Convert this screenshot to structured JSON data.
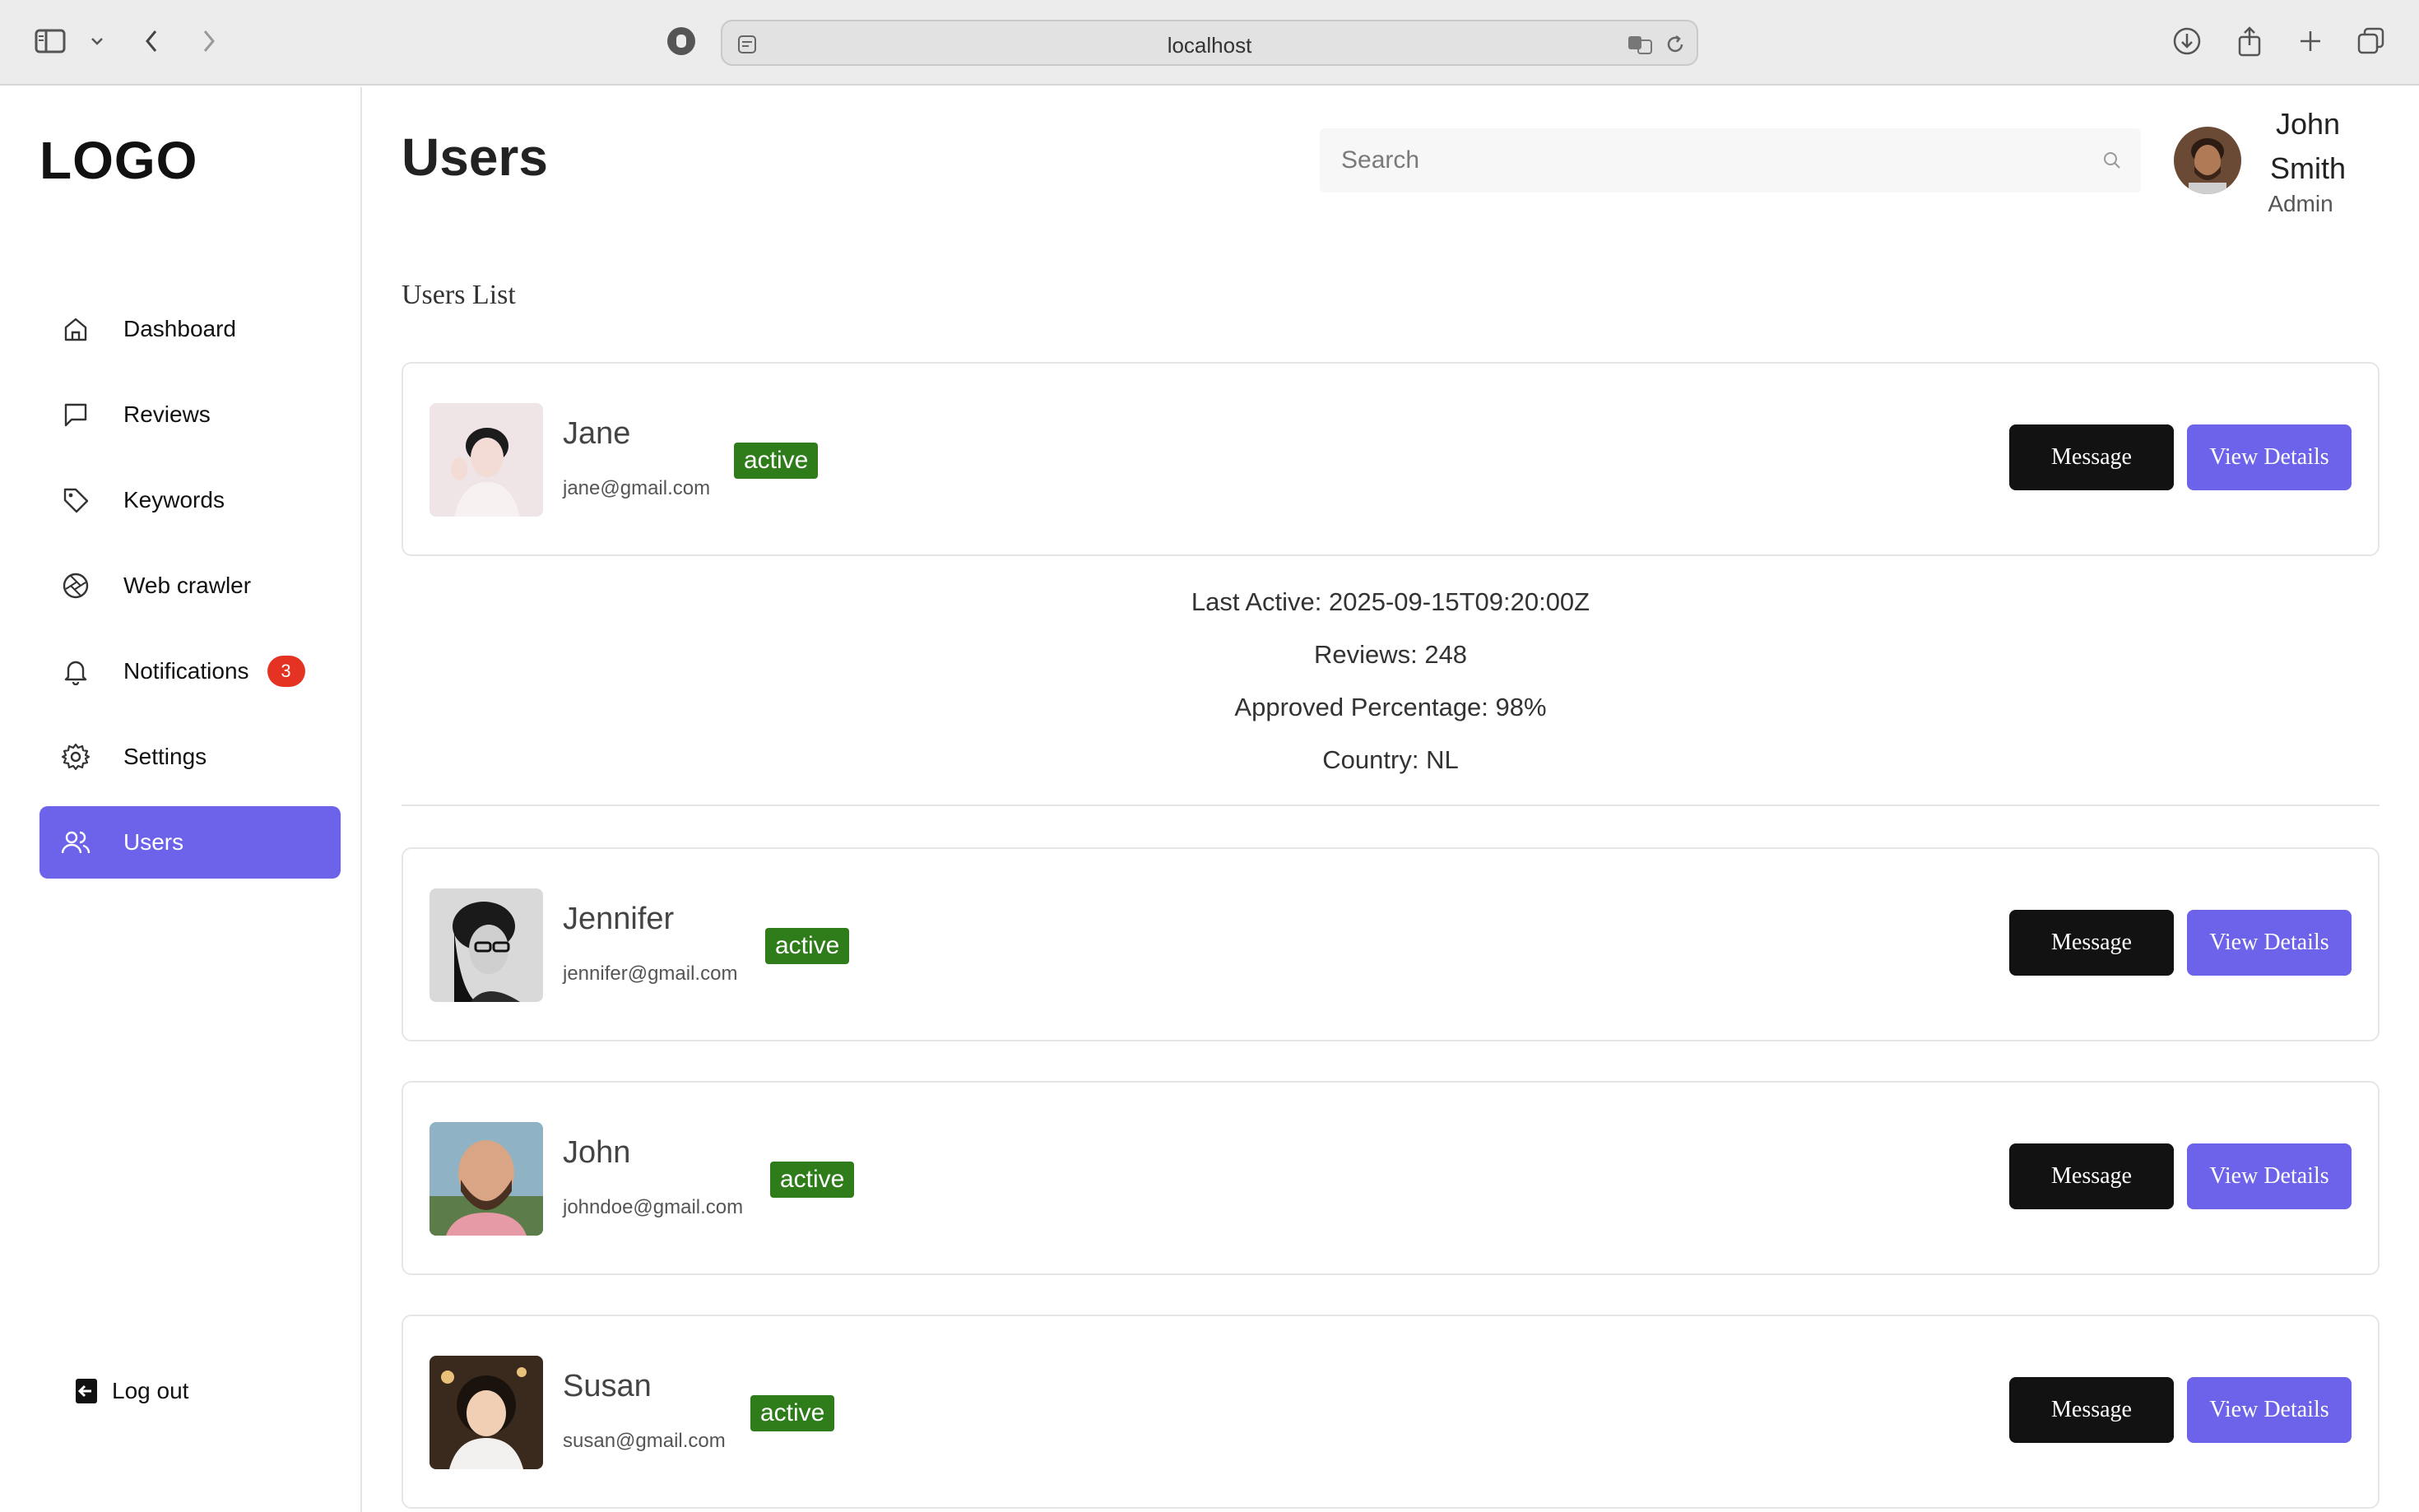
{
  "browser": {
    "host": "localhost"
  },
  "sidebar": {
    "logo": "LOGO",
    "items": [
      {
        "label": "Dashboard",
        "icon": "home-icon"
      },
      {
        "label": "Reviews",
        "icon": "message-square-icon"
      },
      {
        "label": "Keywords",
        "icon": "tag-icon"
      },
      {
        "label": "Web crawler",
        "icon": "aperture-icon"
      },
      {
        "label": "Notifications",
        "icon": "bell-icon",
        "badge": "3"
      },
      {
        "label": "Settings",
        "icon": "gear-icon"
      },
      {
        "label": "Users",
        "icon": "users-icon",
        "active": true
      }
    ],
    "logout_label": "Log out"
  },
  "header": {
    "title": "Users",
    "search_placeholder": "Search",
    "profile": {
      "name": "John Smith",
      "role": "Admin"
    }
  },
  "main": {
    "section_title": "Users List",
    "message_label": "Message",
    "view_details_label": "View Details",
    "users": [
      {
        "name": "Jane",
        "email": "jane@gmail.com",
        "status": "active"
      },
      {
        "name": "Jennifer",
        "email": "jennifer@gmail.com",
        "status": "active"
      },
      {
        "name": "John",
        "email": "johndoe@gmail.com",
        "status": "active"
      },
      {
        "name": "Susan",
        "email": "susan@gmail.com",
        "status": "active"
      }
    ],
    "expanded_details": {
      "last_active": "Last Active: 2025-09-15T09:20:00Z",
      "reviews": "Reviews: 248",
      "approved": "Approved Percentage: 98%",
      "country": "Country: NL"
    }
  },
  "colors": {
    "accent": "#6c63ea",
    "status_active": "#2e7d1a",
    "badge": "#e53323",
    "message_button": "#121212"
  }
}
